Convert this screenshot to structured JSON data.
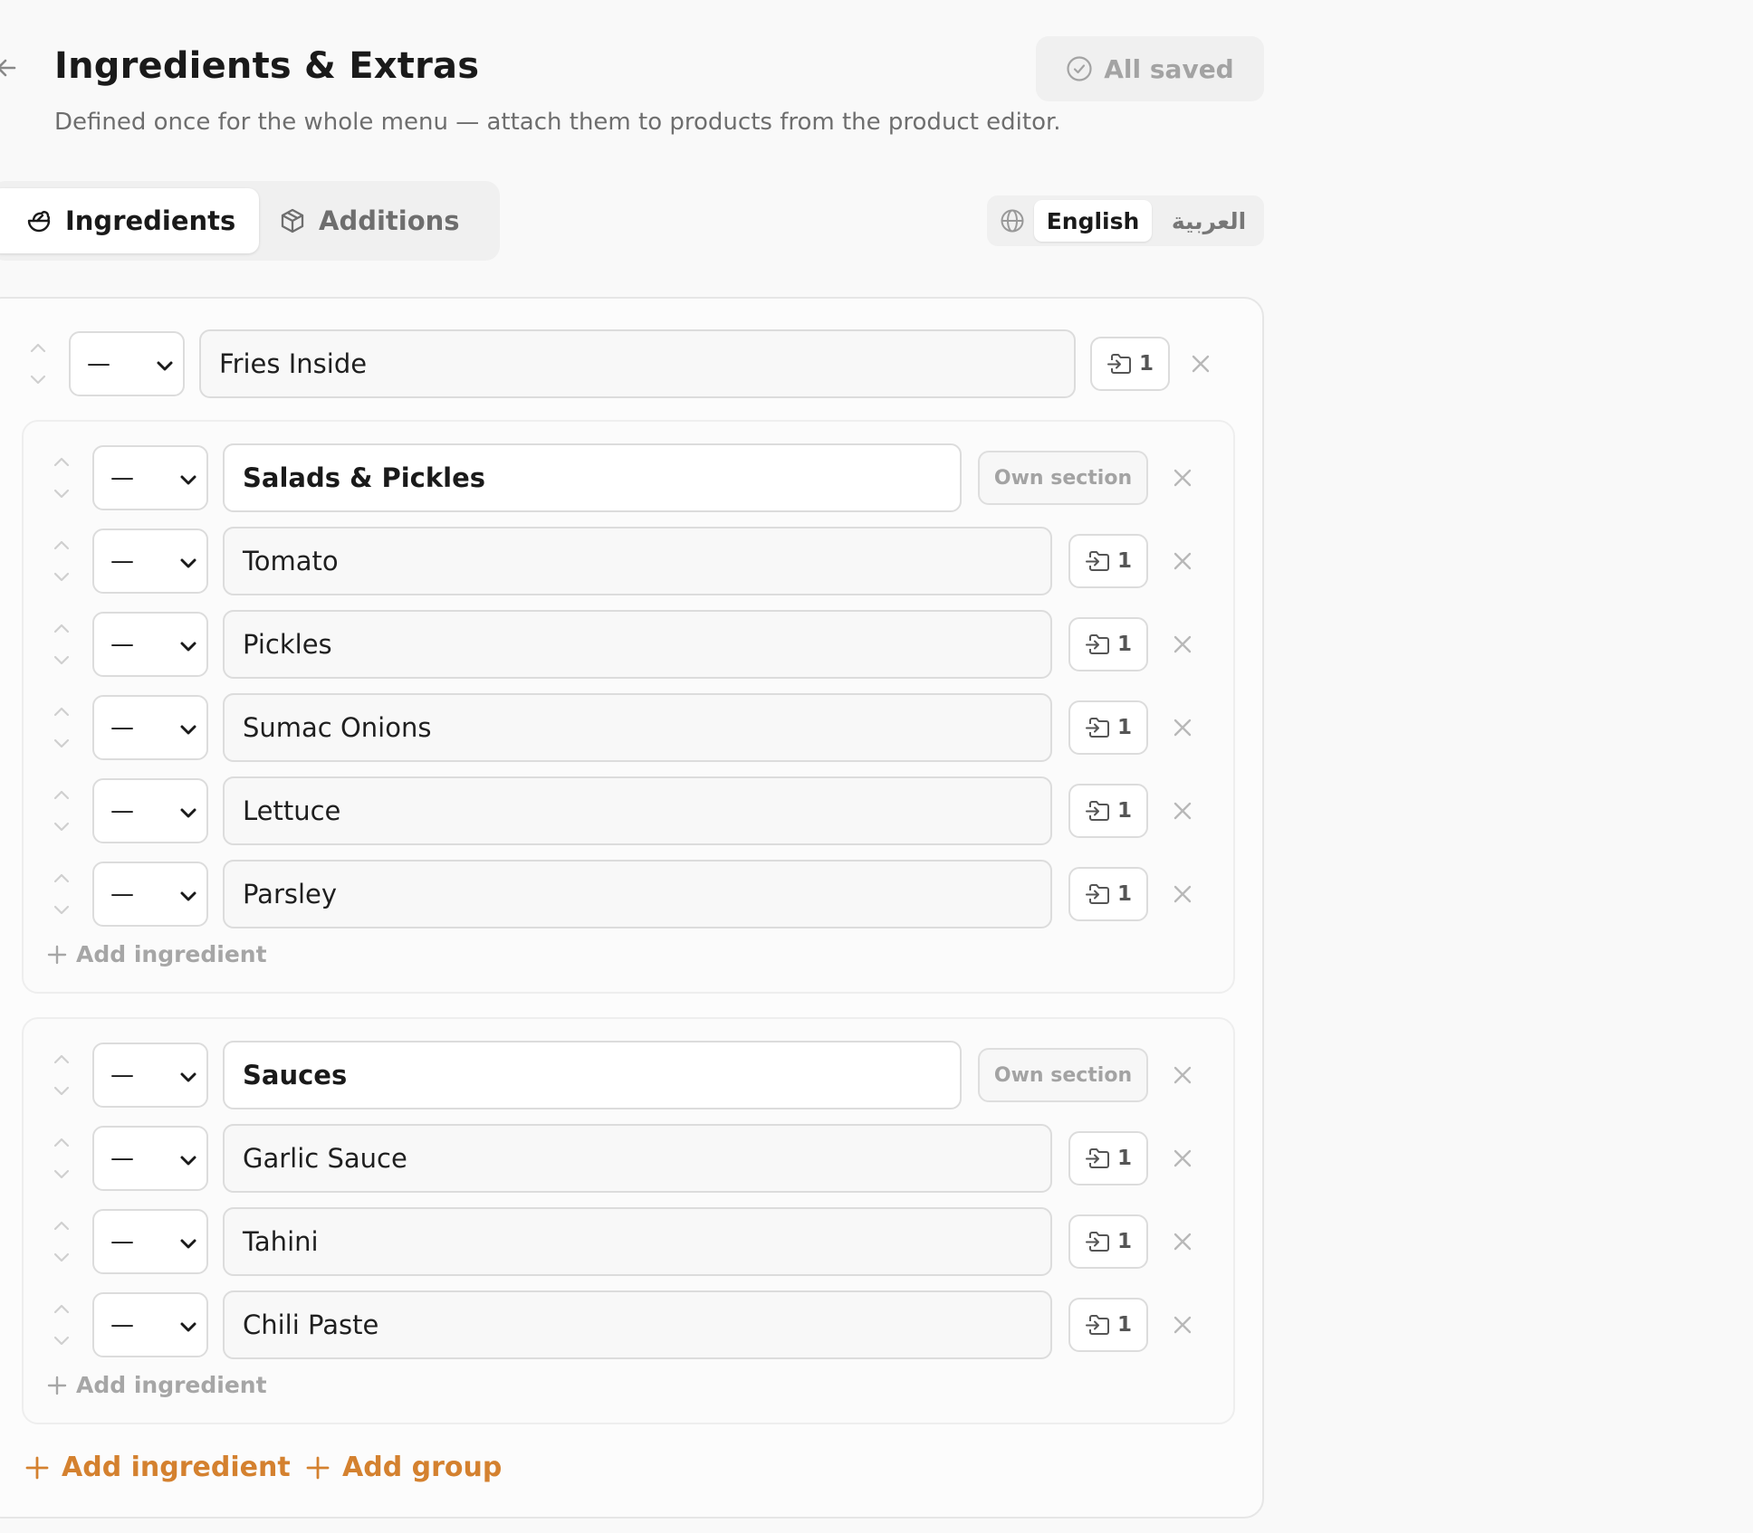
{
  "header": {
    "title": "Ingredients & Extras",
    "subtitle": "Defined once for the whole menu — attach them to products from the product editor.",
    "save_status": "All saved"
  },
  "tabs": [
    {
      "label": "Ingredients",
      "icon": "salad-icon",
      "active": true
    },
    {
      "label": "Additions",
      "icon": "package-icon",
      "active": false
    }
  ],
  "language": {
    "options": [
      "English",
      "العربية"
    ],
    "selected": "English"
  },
  "ungrouped_items": [
    {
      "name": "Fries Inside",
      "level": "—",
      "product_count": "1"
    }
  ],
  "groups": [
    {
      "name": "Salads & Pickles",
      "level": "—",
      "section_label": "Own section",
      "items": [
        {
          "name": "Tomato",
          "level": "—",
          "product_count": "1"
        },
        {
          "name": "Pickles",
          "level": "—",
          "product_count": "1"
        },
        {
          "name": "Sumac Onions",
          "level": "—",
          "product_count": "1"
        },
        {
          "name": "Lettuce",
          "level": "—",
          "product_count": "1"
        },
        {
          "name": "Parsley",
          "level": "—",
          "product_count": "1"
        }
      ],
      "add_label": "Add ingredient"
    },
    {
      "name": "Sauces",
      "level": "—",
      "section_label": "Own section",
      "items": [
        {
          "name": "Garlic Sauce",
          "level": "—",
          "product_count": "1"
        },
        {
          "name": "Tahini",
          "level": "—",
          "product_count": "1"
        },
        {
          "name": "Chili Paste",
          "level": "—",
          "product_count": "1"
        }
      ],
      "add_label": "Add ingredient"
    }
  ],
  "footer_actions": {
    "add_ingredient": "Add ingredient",
    "add_group": "Add group"
  },
  "colors": {
    "accent": "#d4812f",
    "muted": "#a6a6a6",
    "border": "#dcdcdc"
  }
}
